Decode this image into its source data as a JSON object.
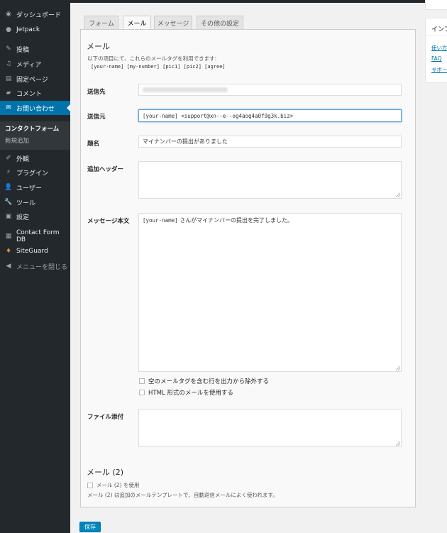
{
  "sidebar": {
    "items": [
      {
        "label": "ダッシュボード",
        "icon": "dashboard-icon"
      },
      {
        "label": "Jetpack",
        "icon": "jetpack-icon"
      },
      {
        "label": "投稿",
        "icon": "pin-icon"
      },
      {
        "label": "メディア",
        "icon": "media-icon"
      },
      {
        "label": "固定ページ",
        "icon": "page-icon"
      },
      {
        "label": "コメント",
        "icon": "comment-icon"
      },
      {
        "label": "お問い合わせ",
        "icon": "mail-icon"
      },
      {
        "label": "外観",
        "icon": "brush-icon"
      },
      {
        "label": "プラグイン",
        "icon": "plugin-icon"
      },
      {
        "label": "ユーザー",
        "icon": "user-icon"
      },
      {
        "label": "ツール",
        "icon": "wrench-icon"
      },
      {
        "label": "設定",
        "icon": "settings-icon"
      },
      {
        "label": "Contact Form DB",
        "icon": "database-icon"
      },
      {
        "label": "SiteGuard",
        "icon": "guard-icon"
      },
      {
        "label": "メニューを閉じる",
        "icon": "collapse-icon"
      }
    ],
    "submenu": {
      "current": "コンタクトフォーム",
      "other": "新規追加"
    }
  },
  "tabs": [
    "フォーム",
    "メール",
    "メッセージ",
    "その他の設定"
  ],
  "mail": {
    "heading": "メール",
    "description": "以下の項目にて、これらのメールタグを利用できます:",
    "tags": "[your-name] [my-number] [pic1] [pic2] [agree]",
    "to_label": "送信先",
    "from_label": "送信元",
    "from_value": "[your-name] <support@xn--e--og4aog4a0f9g3k.biz>",
    "subject_label": "題名",
    "subject_value": "マイナンバーの提出がありました",
    "headers_label": "追加ヘッダー",
    "body_label": "メッセージ本文",
    "body_tag": "[your-name]",
    "body_text": " さんがマイナンバーの提出を完了しました。",
    "exclude_blank_label": "空のメールタグを含む行を出力から除外する",
    "html_label": "HTML 形式のメールを使用する",
    "attachments_label": "ファイル添付"
  },
  "mail2": {
    "heading": "メール (2)",
    "use_label": "メール (2) を使用",
    "note": "メール (2) は追加のメールテンプレートで、自動返信メールによく使われます。"
  },
  "save_label": "保存",
  "info_box": {
    "title": "インフォメーション",
    "links": [
      "使い方",
      "FAQ",
      "サポート"
    ]
  }
}
